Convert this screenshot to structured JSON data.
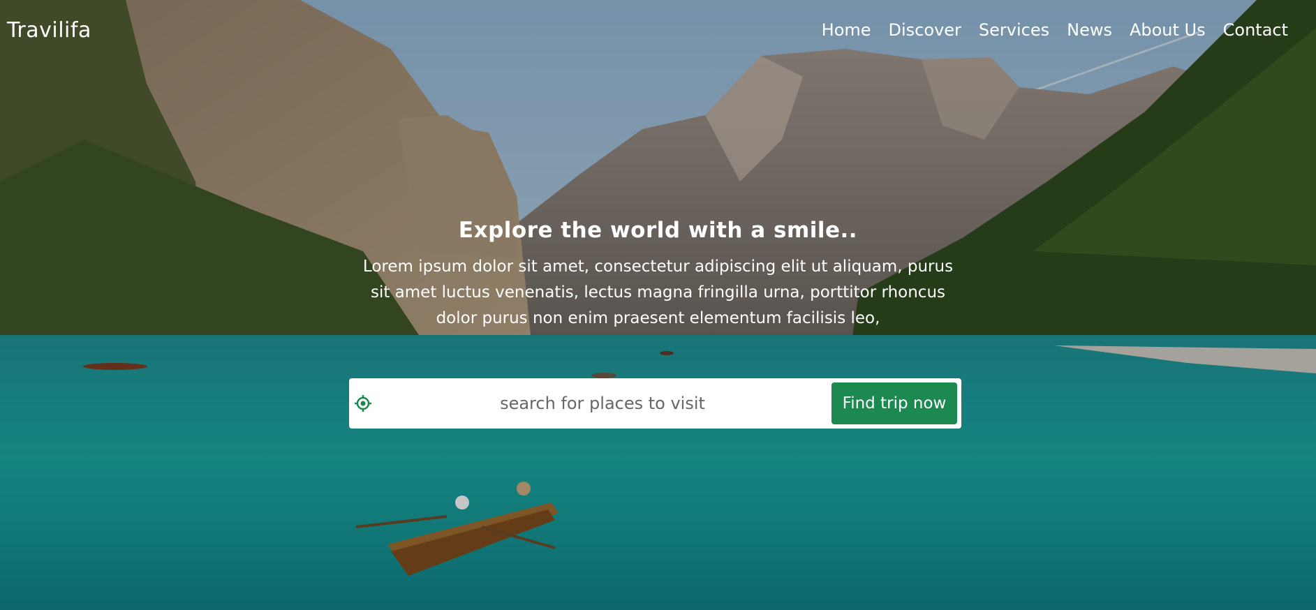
{
  "brand": {
    "name": "Travilifa"
  },
  "nav": {
    "items": [
      {
        "label": "Home"
      },
      {
        "label": "Discover"
      },
      {
        "label": "Services"
      },
      {
        "label": "News"
      },
      {
        "label": "About Us"
      },
      {
        "label": "Contact"
      }
    ]
  },
  "hero": {
    "title": "Explore the world with a smile..",
    "text": "Lorem ipsum dolor sit amet, consectetur adipiscing elit ut aliquam, purus sit amet luctus venenatis, lectus magna fringilla urna, porttitor rhoncus dolor purus non enim praesent elementum facilisis leo,"
  },
  "search": {
    "placeholder": "search for places to visit",
    "button_label": "Find trip now",
    "icon": "location-crosshair-icon"
  },
  "colors": {
    "accent": "#1c8a50",
    "text_on_hero": "#ffffff",
    "search_background": "#ffffff"
  }
}
